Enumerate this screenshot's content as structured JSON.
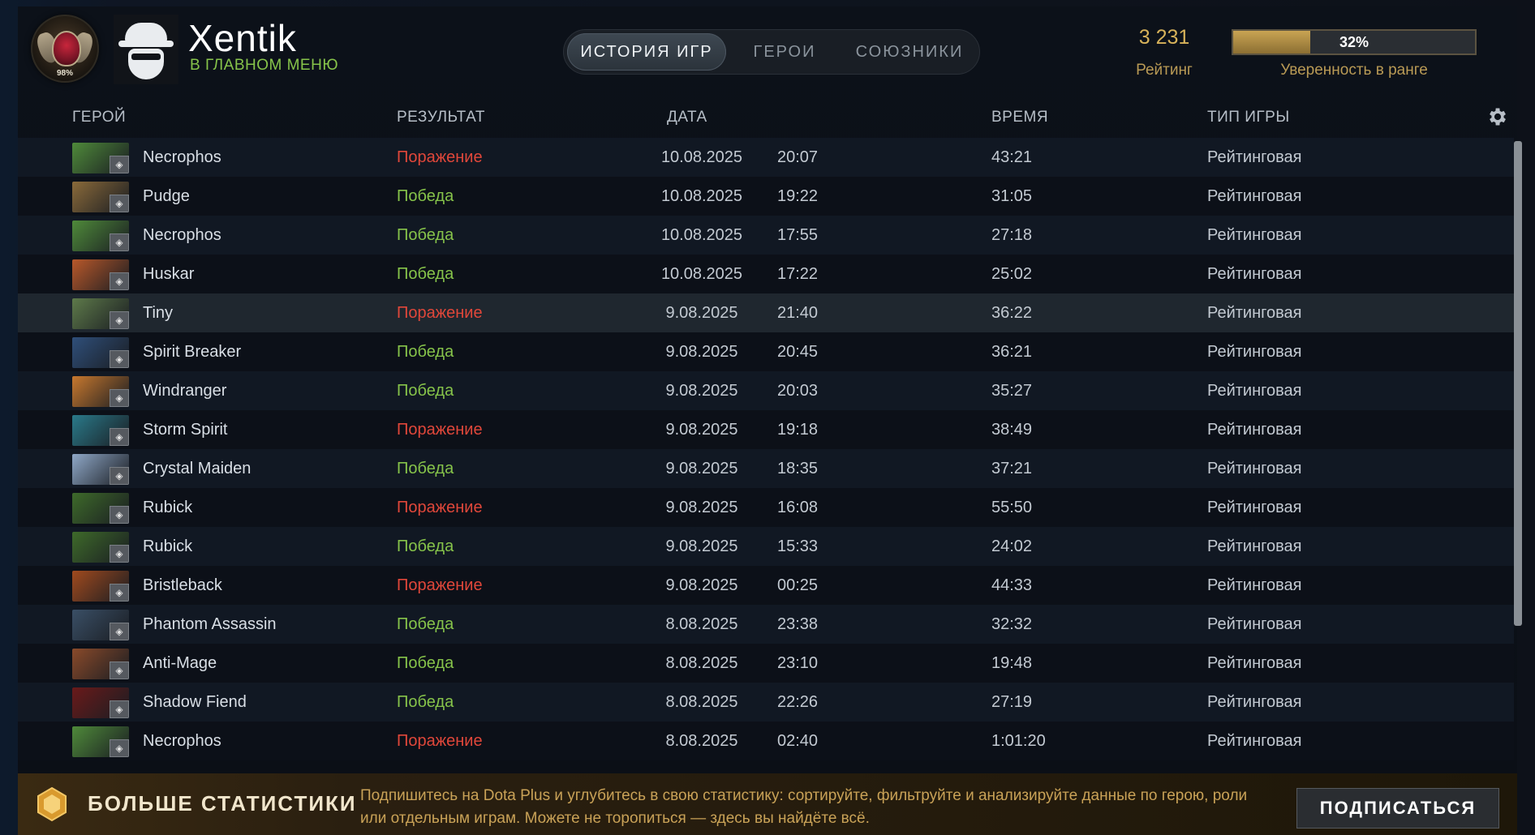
{
  "header": {
    "rank_percent": "98%",
    "username": "Xentik",
    "back_link": "В ГЛАВНОМ МЕНЮ",
    "tabs": [
      {
        "label": "ИСТОРИЯ ИГР",
        "active": true
      },
      {
        "label": "ГЕРОИ",
        "active": false
      },
      {
        "label": "СОЮЗНИКИ",
        "active": false
      }
    ],
    "rating_value": "3 231",
    "rating_label": "Рейтинг",
    "confidence_value": "32%",
    "confidence_fraction": 0.32,
    "confidence_label": "Уверенность в ранге"
  },
  "table": {
    "columns": {
      "hero": "ГЕРОЙ",
      "result": "РЕЗУЛЬТАТ",
      "date": "ДАТА",
      "duration": "ВРЕМЯ",
      "game_type": "ТИП ИГРЫ"
    },
    "rows": [
      {
        "hero": "Necrophos",
        "result": "Поражение",
        "win": false,
        "date": "10.08.2025",
        "time": "20:07",
        "duration": "43:21",
        "type": "Рейтинговая",
        "color": "#4f8a3a"
      },
      {
        "hero": "Pudge",
        "result": "Победа",
        "win": true,
        "date": "10.08.2025",
        "time": "19:22",
        "duration": "31:05",
        "type": "Рейтинговая",
        "color": "#8a6a3a"
      },
      {
        "hero": "Necrophos",
        "result": "Победа",
        "win": true,
        "date": "10.08.2025",
        "time": "17:55",
        "duration": "27:18",
        "type": "Рейтинговая",
        "color": "#4f8a3a"
      },
      {
        "hero": "Huskar",
        "result": "Победа",
        "win": true,
        "date": "10.08.2025",
        "time": "17:22",
        "duration": "25:02",
        "type": "Рейтинговая",
        "color": "#b8582a"
      },
      {
        "hero": "Tiny",
        "result": "Поражение",
        "win": false,
        "date": "9.08.2025",
        "time": "21:40",
        "duration": "36:22",
        "type": "Рейтинговая",
        "color": "#5e7a4a"
      },
      {
        "hero": "Spirit Breaker",
        "result": "Победа",
        "win": true,
        "date": "9.08.2025",
        "time": "20:45",
        "duration": "36:21",
        "type": "Рейтинговая",
        "color": "#2f4f7a"
      },
      {
        "hero": "Windranger",
        "result": "Победа",
        "win": true,
        "date": "9.08.2025",
        "time": "20:03",
        "duration": "35:27",
        "type": "Рейтинговая",
        "color": "#c7782e"
      },
      {
        "hero": "Storm Spirit",
        "result": "Поражение",
        "win": false,
        "date": "9.08.2025",
        "time": "19:18",
        "duration": "38:49",
        "type": "Рейтинговая",
        "color": "#2a7a8a"
      },
      {
        "hero": "Crystal Maiden",
        "result": "Победа",
        "win": true,
        "date": "9.08.2025",
        "time": "18:35",
        "duration": "37:21",
        "type": "Рейтинговая",
        "color": "#8fa8c8"
      },
      {
        "hero": "Rubick",
        "result": "Поражение",
        "win": false,
        "date": "9.08.2025",
        "time": "16:08",
        "duration": "55:50",
        "type": "Рейтинговая",
        "color": "#3e6a2a"
      },
      {
        "hero": "Rubick",
        "result": "Победа",
        "win": true,
        "date": "9.08.2025",
        "time": "15:33",
        "duration": "24:02",
        "type": "Рейтинговая",
        "color": "#3e6a2a"
      },
      {
        "hero": "Bristleback",
        "result": "Поражение",
        "win": false,
        "date": "9.08.2025",
        "time": "00:25",
        "duration": "44:33",
        "type": "Рейтинговая",
        "color": "#a04a1e"
      },
      {
        "hero": "Phantom Assassin",
        "result": "Победа",
        "win": true,
        "date": "8.08.2025",
        "time": "23:38",
        "duration": "32:32",
        "type": "Рейтинговая",
        "color": "#3a4f66"
      },
      {
        "hero": "Anti-Mage",
        "result": "Победа",
        "win": true,
        "date": "8.08.2025",
        "time": "23:10",
        "duration": "19:48",
        "type": "Рейтинговая",
        "color": "#8a4a2a"
      },
      {
        "hero": "Shadow Fiend",
        "result": "Победа",
        "win": true,
        "date": "8.08.2025",
        "time": "22:26",
        "duration": "27:19",
        "type": "Рейтинговая",
        "color": "#6a1a1a"
      },
      {
        "hero": "Necrophos",
        "result": "Поражение",
        "win": false,
        "date": "8.08.2025",
        "time": "02:40",
        "duration": "1:01:20",
        "type": "Рейтинговая",
        "color": "#4f8a3a"
      }
    ]
  },
  "banner": {
    "title": "БОЛЬШЕ СТАТИСТИКИ",
    "text": "Подпишитесь на Dota Plus и углубитесь в свою статистику: сортируйте, фильтруйте и анализируйте данные по герою, роли или отдельным играм. Можете не торопиться — здесь вы найдёте всё.",
    "button": "ПОДПИСАТЬСЯ"
  },
  "colors": {
    "win": "#86c34a",
    "loss": "#e0473a",
    "accent_gold": "#d7b25a"
  }
}
